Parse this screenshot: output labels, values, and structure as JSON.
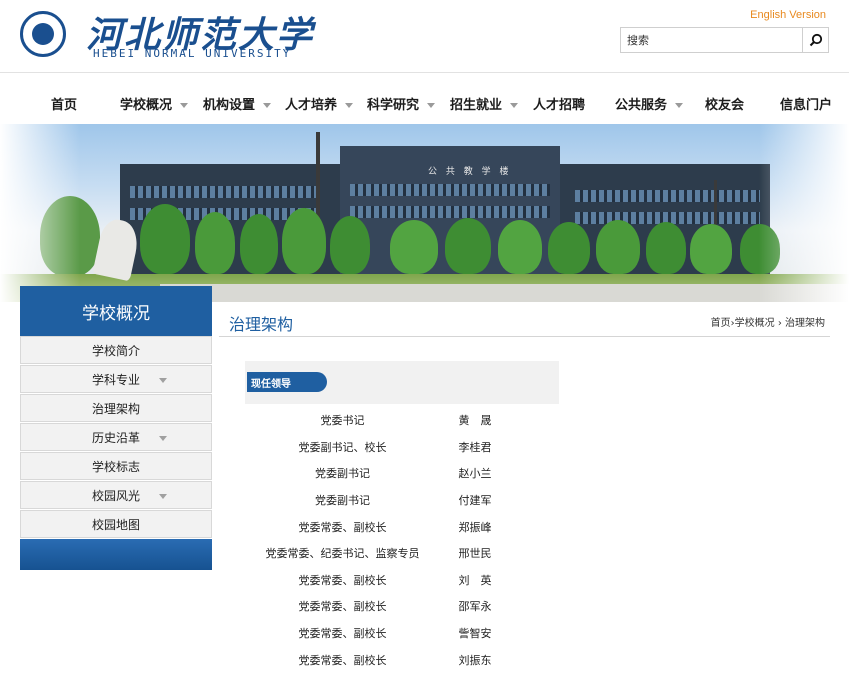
{
  "header": {
    "logo_cn": "河北师范大学",
    "logo_en": "HEBEI NORMAL UNIVERSITY",
    "english_version": "English Version",
    "search_placeholder": "搜索"
  },
  "nav": {
    "items": [
      {
        "label": "首页",
        "has_dropdown": false
      },
      {
        "label": "学校概况",
        "has_dropdown": true
      },
      {
        "label": "机构设置",
        "has_dropdown": true
      },
      {
        "label": "人才培养",
        "has_dropdown": true
      },
      {
        "label": "科学研究",
        "has_dropdown": true
      },
      {
        "label": "招生就业",
        "has_dropdown": true
      },
      {
        "label": "人才招聘",
        "has_dropdown": false
      },
      {
        "label": "公共服务",
        "has_dropdown": true
      },
      {
        "label": "校友会",
        "has_dropdown": false
      },
      {
        "label": "信息门户",
        "has_dropdown": false
      }
    ]
  },
  "banner": {
    "building_sign": "公 共 教 学 楼"
  },
  "sidebar": {
    "title": "学校概况",
    "items": [
      {
        "label": "学校简介",
        "has_dropdown": false
      },
      {
        "label": "学科专业",
        "has_dropdown": true
      },
      {
        "label": "治理架构",
        "has_dropdown": false
      },
      {
        "label": "历史沿革",
        "has_dropdown": true
      },
      {
        "label": "学校标志",
        "has_dropdown": false
      },
      {
        "label": "校园风光",
        "has_dropdown": true
      },
      {
        "label": "校园地图",
        "has_dropdown": false
      }
    ]
  },
  "content": {
    "title": "治理架构",
    "breadcrumb": "首页›学校概况 › 治理架构",
    "section_label": "现任领导",
    "leaders": [
      {
        "title": "党委书记",
        "name": "黄　晟"
      },
      {
        "title": "党委副书记、校长",
        "name": "李桂君"
      },
      {
        "title": "党委副书记",
        "name": "赵小兰"
      },
      {
        "title": "党委副书记",
        "name": "付建军"
      },
      {
        "title": "党委常委、副校长",
        "name": "郑振峰"
      },
      {
        "title": "党委常委、纪委书记、监察专员",
        "name": "邢世民"
      },
      {
        "title": "党委常委、副校长",
        "name": "刘　英"
      },
      {
        "title": "党委常委、副校长",
        "name": "邵军永"
      },
      {
        "title": "党委常委、副校长",
        "name": "訾智安"
      },
      {
        "title": "党委常委、副校长",
        "name": "刘振东"
      }
    ]
  },
  "colors": {
    "primary_blue": "#1f5fa1",
    "accent_orange": "#e8891f"
  }
}
